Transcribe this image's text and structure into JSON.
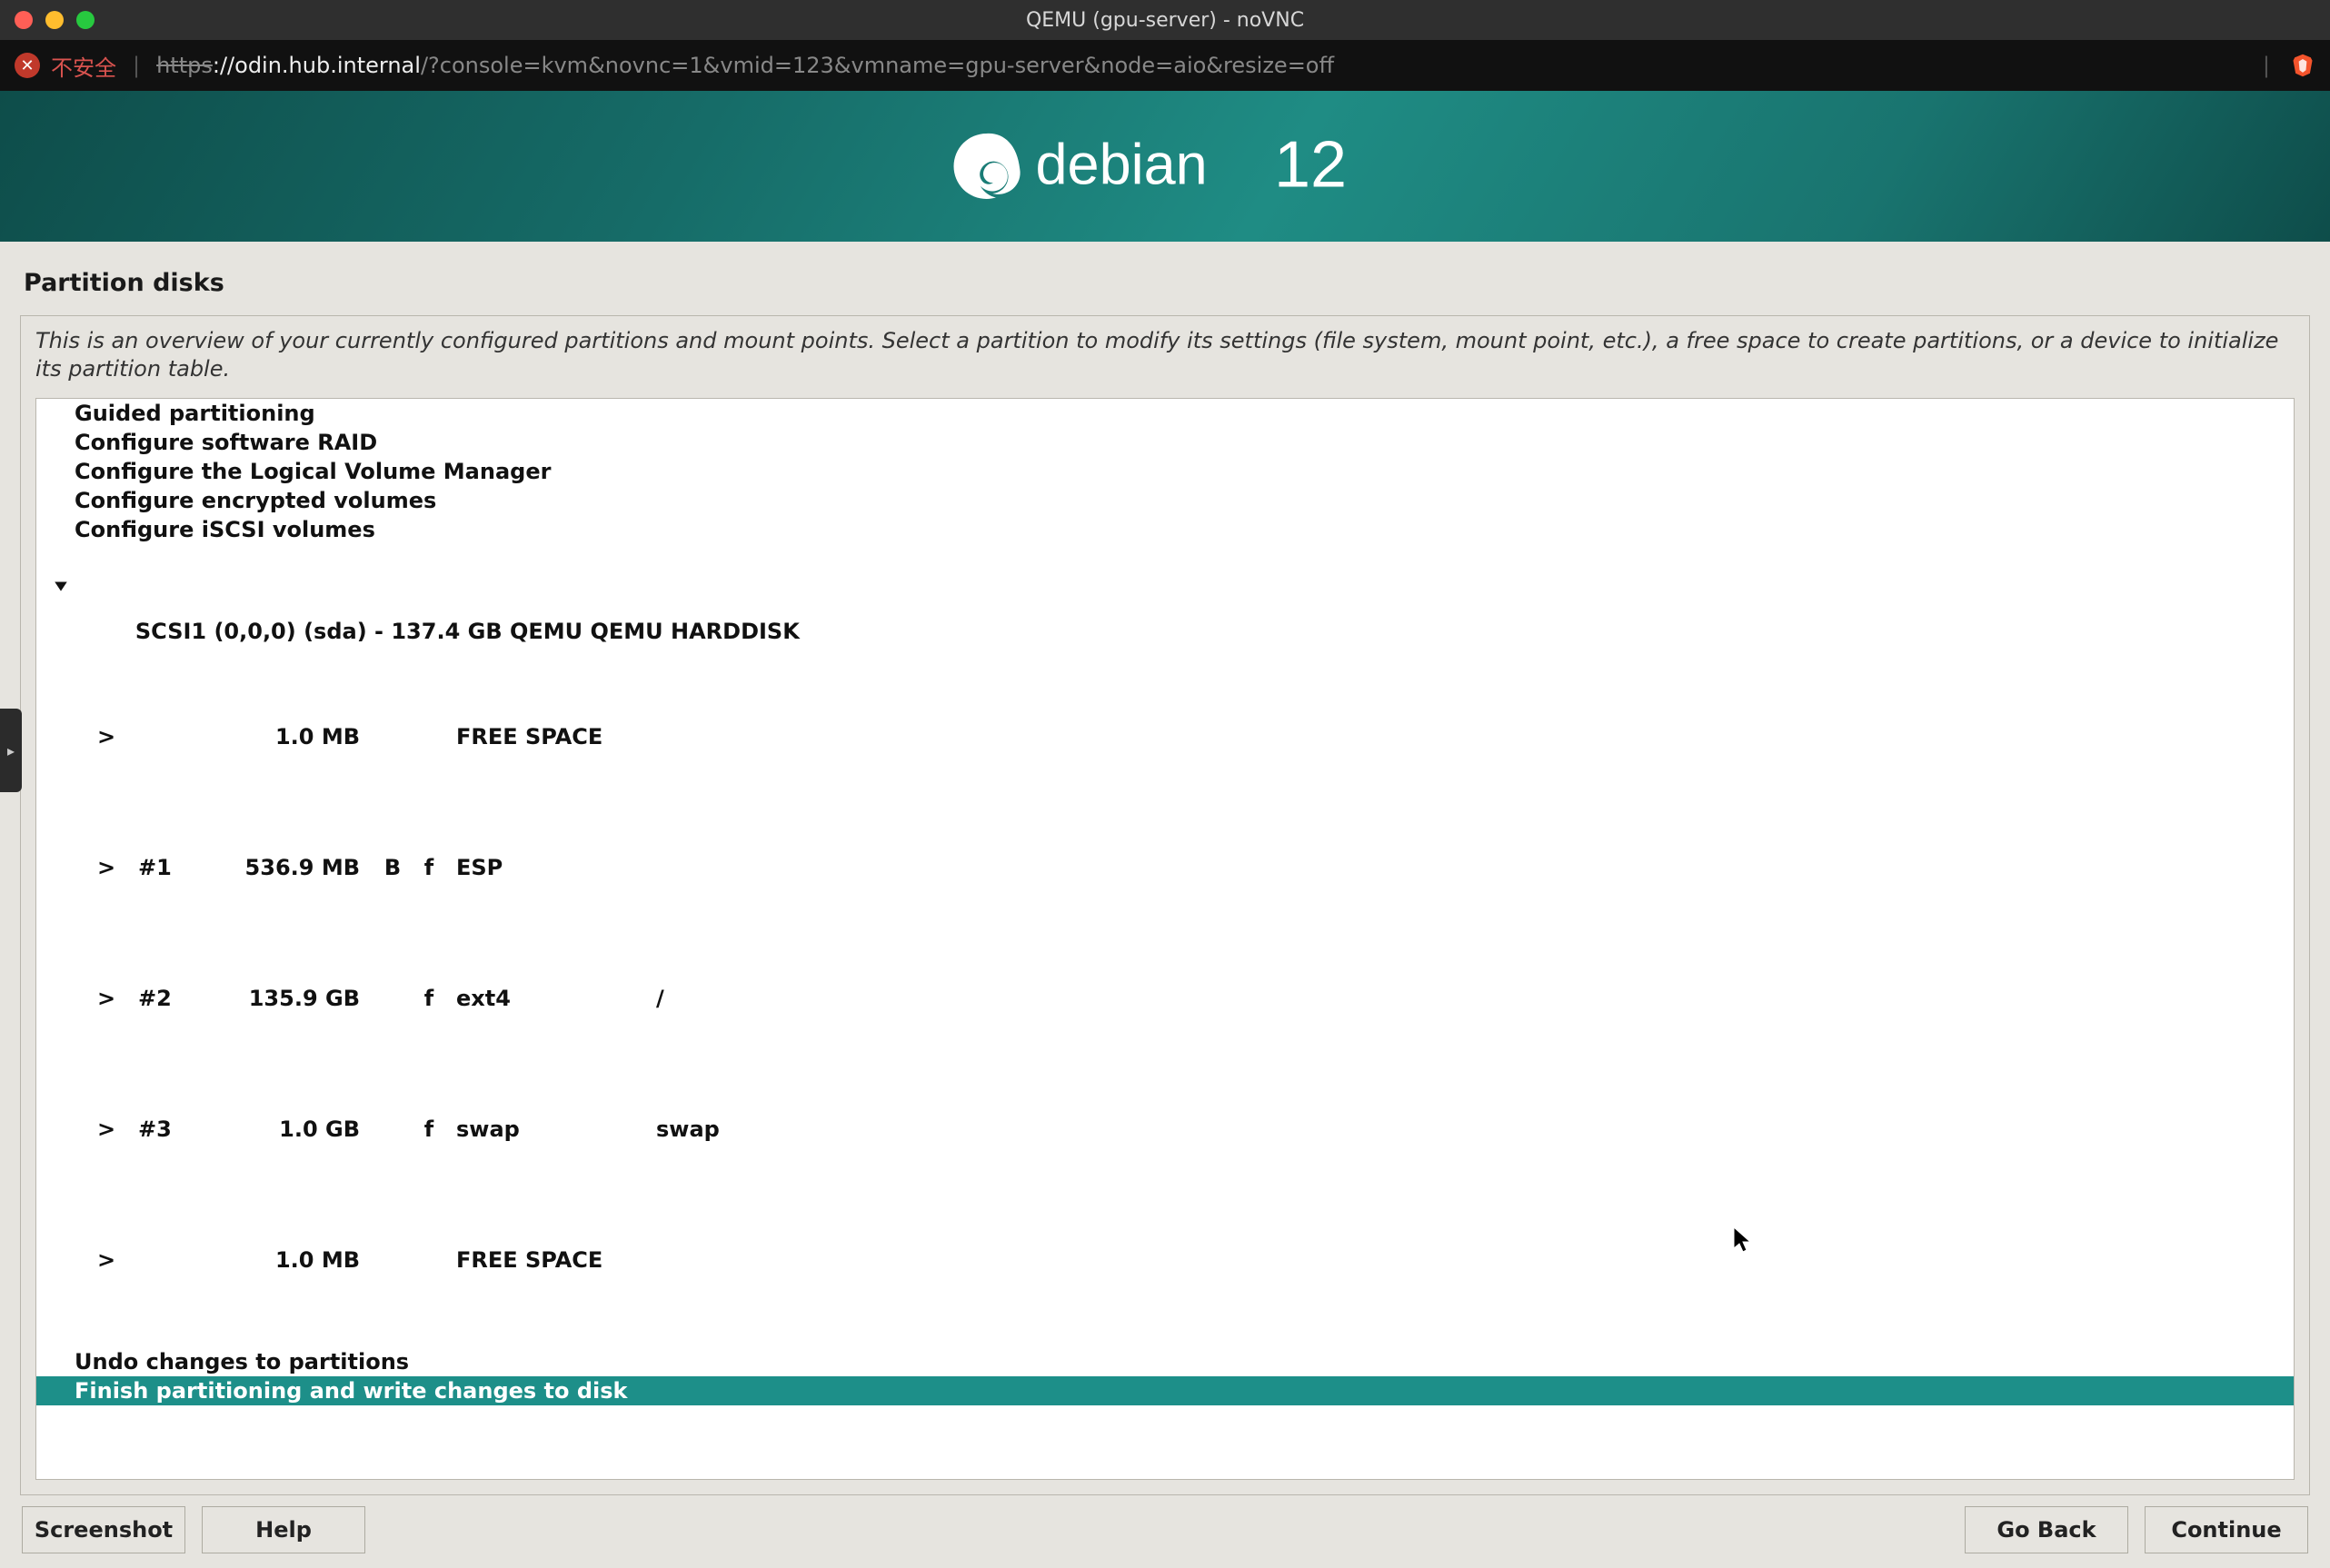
{
  "window": {
    "title": "QEMU (gpu-server) - noVNC"
  },
  "addressbar": {
    "warn_label": "不安全",
    "url_scheme": "https",
    "url_host": "://odin.hub.internal",
    "url_path": "/?console=kvm&novnc=1&vmid=123&vmname=gpu-server&node=aio&resize=off"
  },
  "banner": {
    "distro_name": "debian",
    "distro_version": "12"
  },
  "page": {
    "title": "Partition disks",
    "instructions": "This is an overview of your currently configured partitions and mount points. Select a partition to modify its settings (file system, mount point, etc.), a free space to create partitions, or a device to initialize its partition table."
  },
  "menu_top": [
    "Guided partitioning",
    "Configure software RAID",
    "Configure the Logical Volume Manager",
    "Configure encrypted volumes",
    "Configure iSCSI volumes"
  ],
  "device": {
    "label": "SCSI1 (0,0,0) (sda) - 137.4 GB QEMU QEMU HARDDISK",
    "rows": [
      {
        "arrow": ">",
        "num": "",
        "size": "1.0 MB",
        "b": "",
        "f": "",
        "fs": "FREE SPACE",
        "mp": ""
      },
      {
        "arrow": ">",
        "num": "#1",
        "size": "536.9 MB",
        "b": "B",
        "f": "f",
        "fs": "ESP",
        "mp": ""
      },
      {
        "arrow": ">",
        "num": "#2",
        "size": "135.9 GB",
        "b": "",
        "f": "f",
        "fs": "ext4",
        "mp": "/"
      },
      {
        "arrow": ">",
        "num": "#3",
        "size": "1.0 GB",
        "b": "",
        "f": "f",
        "fs": "swap",
        "mp": "swap"
      },
      {
        "arrow": ">",
        "num": "",
        "size": "1.0 MB",
        "b": "",
        "f": "",
        "fs": "FREE SPACE",
        "mp": ""
      }
    ]
  },
  "menu_bottom": {
    "undo": "Undo changes to partitions",
    "finish": "Finish partitioning and write changes to disk"
  },
  "buttons": {
    "screenshot": "Screenshot",
    "help": "Help",
    "back": "Go Back",
    "continue": "Continue"
  }
}
